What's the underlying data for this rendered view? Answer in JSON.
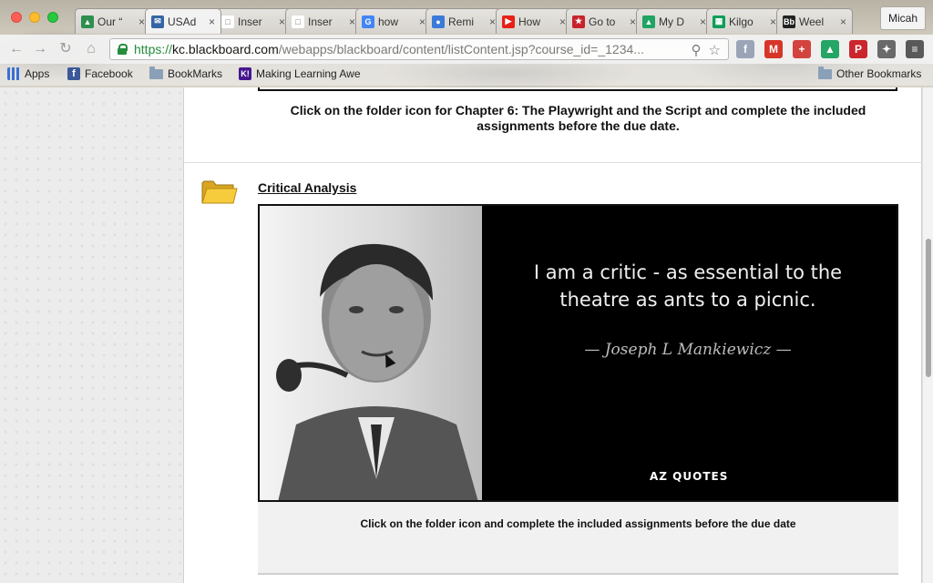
{
  "window": {
    "user": "Micah"
  },
  "tabs": [
    {
      "title": "Our “",
      "fav_color": "#2f8f4e",
      "fav_glyph": "▲"
    },
    {
      "title": "USAd",
      "fav_color": "#3465a4",
      "fav_glyph": "✉",
      "active": true
    },
    {
      "title": "Inser",
      "fav_color": "#ffffff",
      "fav_glyph": "□"
    },
    {
      "title": "Inser",
      "fav_color": "#ffffff",
      "fav_glyph": "□"
    },
    {
      "title": "how",
      "fav_color": "#4285f4",
      "fav_glyph": "G"
    },
    {
      "title": "Remi",
      "fav_color": "#3b7ad8",
      "fav_glyph": "●"
    },
    {
      "title": "How",
      "fav_color": "#e62117",
      "fav_glyph": "▶"
    },
    {
      "title": "Go to",
      "fav_color": "#c8232c",
      "fav_glyph": "★"
    },
    {
      "title": "My D",
      "fav_color": "#1fa463",
      "fav_glyph": "▲"
    },
    {
      "title": "Kilgo",
      "fav_color": "#0f9d58",
      "fav_glyph": "▦"
    },
    {
      "title": "Weel",
      "fav_color": "#222222",
      "fav_glyph": "Bb"
    }
  ],
  "toolbar": {
    "url_scheme": "https://",
    "url_host": "kc.blackboard.com",
    "url_path": "/webapps/blackboard/content/listContent.jsp?course_id=_1234..."
  },
  "extensions": [
    {
      "name": "facebook-icon",
      "glyph": "f",
      "color": "#9aa4b8"
    },
    {
      "name": "gmail-icon",
      "glyph": "M",
      "color": "#d93025"
    },
    {
      "name": "plus-icon",
      "glyph": "+",
      "color": "#d43f3a"
    },
    {
      "name": "drive-icon",
      "glyph": "▲",
      "color": "#1fa463"
    },
    {
      "name": "pinterest-icon",
      "glyph": "P",
      "color": "#cb2027"
    },
    {
      "name": "puzzle-icon",
      "glyph": "✦",
      "color": "#666666"
    },
    {
      "name": "menu-icon",
      "glyph": "≡",
      "color": "#555555"
    }
  ],
  "bookmarks": [
    {
      "label": "Apps"
    },
    {
      "label": "Facebook"
    },
    {
      "label": "BookMarks"
    },
    {
      "label": "Making Learning Awe"
    }
  ],
  "other_bookmarks": "Other Bookmarks",
  "content": {
    "previous_instruction": "Click on the folder icon for Chapter 6: The Playwright and the Script and complete the included assignments before the due date.",
    "item_title": "Critical Analysis",
    "quote_line1": "I am a critic - as essential to the",
    "quote_line2": "theatre as ants to a picnic.",
    "quote_author": "—  Joseph L Mankiewicz  —",
    "brand": "AZ QUOTES",
    "caption": "Click on the folder icon and complete the included assignments before the due date"
  }
}
